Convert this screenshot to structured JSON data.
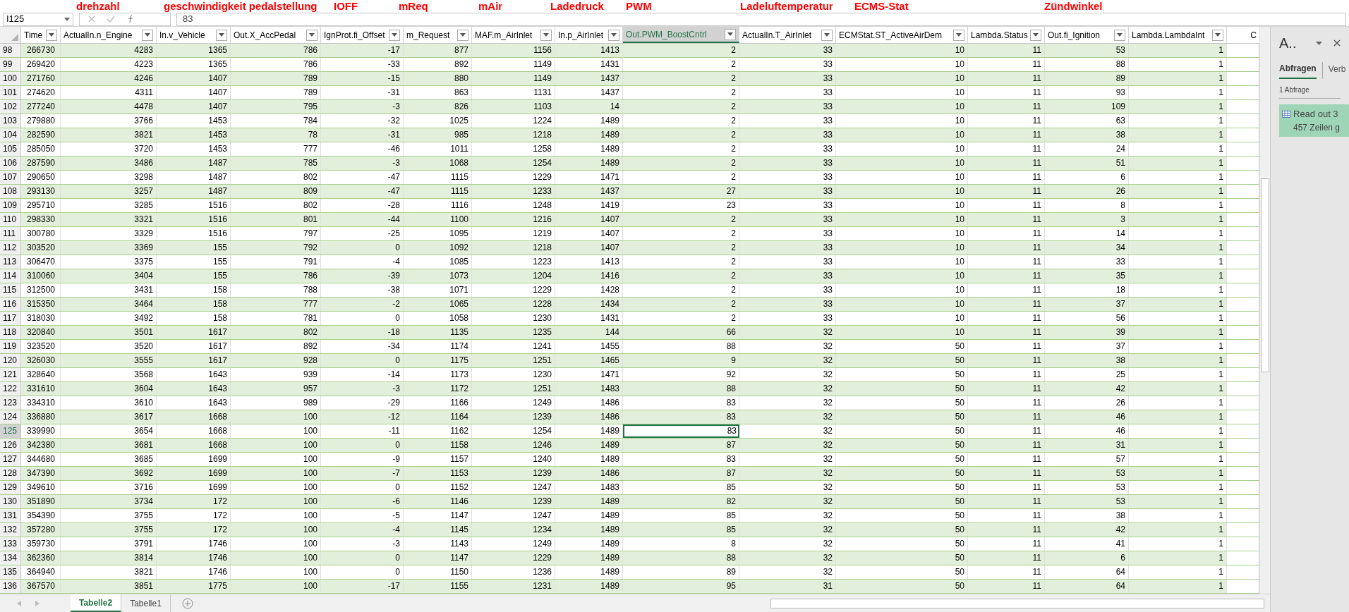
{
  "formula_bar": {
    "name_box": "I125",
    "formula": "83"
  },
  "annotations": [
    "drehzahl",
    "geschwindigkeit pedalstellung",
    "IOFF",
    "mReq",
    "mAir",
    "Ladedruck",
    "PWM",
    "Ladeluftemperatur",
    "ECMS-Stat",
    "Zündwinkel"
  ],
  "table": {
    "columns": [
      {
        "label": "Time",
        "selected": false
      },
      {
        "label": "ActualIn.n_Engine",
        "selected": false
      },
      {
        "label": "In.v_Vehicle",
        "selected": false
      },
      {
        "label": "Out.X_AccPedal",
        "selected": false
      },
      {
        "label": "IgnProt.fi_Offset",
        "selected": false
      },
      {
        "label": "m_Request",
        "selected": false
      },
      {
        "label": "MAF.m_AirInlet",
        "selected": false
      },
      {
        "label": "In.p_AirInlet",
        "selected": false
      },
      {
        "label": "Out.PWM_BoostCntrl",
        "selected": true
      },
      {
        "label": "ActualIn.T_AirInlet",
        "selected": false
      },
      {
        "label": "ECMStat.ST_ActiveAirDem",
        "selected": false
      },
      {
        "label": "Lambda.Status",
        "selected": false
      },
      {
        "label": "Out.fi_Ignition",
        "selected": false
      },
      {
        "label": "Lambda.LambdaInt",
        "selected": false
      }
    ],
    "next_column_header": "C",
    "rows": [
      {
        "number": "98",
        "selected": false,
        "cells": [
          "266730",
          "4283",
          "1365",
          "786",
          "-17",
          "877",
          "1156",
          "1413",
          "2",
          "33",
          "10",
          "11",
          "53",
          "1"
        ]
      },
      {
        "number": "99",
        "selected": false,
        "cells": [
          "269420",
          "4223",
          "1365",
          "786",
          "-33",
          "892",
          "1149",
          "1431",
          "2",
          "33",
          "10",
          "11",
          "88",
          "1"
        ]
      },
      {
        "number": "100",
        "selected": false,
        "cells": [
          "271760",
          "4246",
          "1407",
          "789",
          "-15",
          "880",
          "1149",
          "1437",
          "2",
          "33",
          "10",
          "11",
          "89",
          "1"
        ]
      },
      {
        "number": "101",
        "selected": false,
        "cells": [
          "274620",
          "4311",
          "1407",
          "789",
          "-31",
          "863",
          "1131",
          "1437",
          "2",
          "33",
          "10",
          "11",
          "93",
          "1"
        ]
      },
      {
        "number": "102",
        "selected": false,
        "cells": [
          "277240",
          "4478",
          "1407",
          "795",
          "-3",
          "826",
          "1103",
          "14",
          "2",
          "33",
          "10",
          "11",
          "109",
          "1"
        ]
      },
      {
        "number": "103",
        "selected": false,
        "cells": [
          "279880",
          "3766",
          "1453",
          "784",
          "-32",
          "1025",
          "1224",
          "1489",
          "2",
          "33",
          "10",
          "11",
          "63",
          "1"
        ]
      },
      {
        "number": "104",
        "selected": false,
        "cells": [
          "282590",
          "3821",
          "1453",
          "78",
          "-31",
          "985",
          "1218",
          "1489",
          "2",
          "33",
          "10",
          "11",
          "38",
          "1"
        ]
      },
      {
        "number": "105",
        "selected": false,
        "cells": [
          "285050",
          "3720",
          "1453",
          "777",
          "-46",
          "1011",
          "1258",
          "1489",
          "2",
          "33",
          "10",
          "11",
          "24",
          "1"
        ]
      },
      {
        "number": "106",
        "selected": false,
        "cells": [
          "287590",
          "3486",
          "1487",
          "785",
          "-3",
          "1068",
          "1254",
          "1489",
          "2",
          "33",
          "10",
          "11",
          "51",
          "1"
        ]
      },
      {
        "number": "107",
        "selected": false,
        "cells": [
          "290650",
          "3298",
          "1487",
          "802",
          "-47",
          "1115",
          "1229",
          "1471",
          "2",
          "33",
          "10",
          "11",
          "6",
          "1"
        ]
      },
      {
        "number": "108",
        "selected": false,
        "cells": [
          "293130",
          "3257",
          "1487",
          "809",
          "-47",
          "1115",
          "1233",
          "1437",
          "27",
          "33",
          "10",
          "11",
          "26",
          "1"
        ]
      },
      {
        "number": "109",
        "selected": false,
        "cells": [
          "295710",
          "3285",
          "1516",
          "802",
          "-28",
          "1116",
          "1248",
          "1419",
          "23",
          "33",
          "10",
          "11",
          "8",
          "1"
        ]
      },
      {
        "number": "110",
        "selected": false,
        "cells": [
          "298330",
          "3321",
          "1516",
          "801",
          "-44",
          "1100",
          "1216",
          "1407",
          "2",
          "33",
          "10",
          "11",
          "3",
          "1"
        ]
      },
      {
        "number": "111",
        "selected": false,
        "cells": [
          "300780",
          "3329",
          "1516",
          "797",
          "-25",
          "1095",
          "1219",
          "1407",
          "2",
          "33",
          "10",
          "11",
          "14",
          "1"
        ]
      },
      {
        "number": "112",
        "selected": false,
        "cells": [
          "303520",
          "3369",
          "155",
          "792",
          "0",
          "1092",
          "1218",
          "1407",
          "2",
          "33",
          "10",
          "11",
          "34",
          "1"
        ]
      },
      {
        "number": "113",
        "selected": false,
        "cells": [
          "306470",
          "3375",
          "155",
          "791",
          "-4",
          "1085",
          "1223",
          "1413",
          "2",
          "33",
          "10",
          "11",
          "33",
          "1"
        ]
      },
      {
        "number": "114",
        "selected": false,
        "cells": [
          "310060",
          "3404",
          "155",
          "786",
          "-39",
          "1073",
          "1204",
          "1416",
          "2",
          "33",
          "10",
          "11",
          "35",
          "1"
        ]
      },
      {
        "number": "115",
        "selected": false,
        "cells": [
          "312500",
          "3431",
          "158",
          "788",
          "-38",
          "1071",
          "1229",
          "1428",
          "2",
          "33",
          "10",
          "11",
          "18",
          "1"
        ]
      },
      {
        "number": "116",
        "selected": false,
        "cells": [
          "315350",
          "3464",
          "158",
          "777",
          "-2",
          "1065",
          "1228",
          "1434",
          "2",
          "33",
          "10",
          "11",
          "37",
          "1"
        ]
      },
      {
        "number": "117",
        "selected": false,
        "cells": [
          "318030",
          "3492",
          "158",
          "781",
          "0",
          "1058",
          "1230",
          "1431",
          "2",
          "33",
          "10",
          "11",
          "56",
          "1"
        ]
      },
      {
        "number": "118",
        "selected": false,
        "cells": [
          "320840",
          "3501",
          "1617",
          "802",
          "-18",
          "1135",
          "1235",
          "144",
          "66",
          "32",
          "10",
          "11",
          "39",
          "1"
        ]
      },
      {
        "number": "119",
        "selected": false,
        "cells": [
          "323520",
          "3520",
          "1617",
          "892",
          "-34",
          "1174",
          "1241",
          "1455",
          "88",
          "32",
          "50",
          "11",
          "37",
          "1"
        ]
      },
      {
        "number": "120",
        "selected": false,
        "cells": [
          "326030",
          "3555",
          "1617",
          "928",
          "0",
          "1175",
          "1251",
          "1465",
          "9",
          "32",
          "50",
          "11",
          "38",
          "1"
        ]
      },
      {
        "number": "121",
        "selected": false,
        "cells": [
          "328640",
          "3568",
          "1643",
          "939",
          "-14",
          "1173",
          "1230",
          "1471",
          "92",
          "32",
          "50",
          "11",
          "25",
          "1"
        ]
      },
      {
        "number": "122",
        "selected": false,
        "cells": [
          "331610",
          "3604",
          "1643",
          "957",
          "-3",
          "1172",
          "1251",
          "1483",
          "88",
          "32",
          "50",
          "11",
          "42",
          "1"
        ]
      },
      {
        "number": "123",
        "selected": false,
        "cells": [
          "334310",
          "3610",
          "1643",
          "989",
          "-29",
          "1166",
          "1249",
          "1486",
          "83",
          "32",
          "50",
          "11",
          "26",
          "1"
        ]
      },
      {
        "number": "124",
        "selected": false,
        "cells": [
          "336880",
          "3617",
          "1668",
          "100",
          "-12",
          "1164",
          "1239",
          "1486",
          "83",
          "32",
          "50",
          "11",
          "46",
          "1"
        ]
      },
      {
        "number": "125",
        "selected": true,
        "cells": [
          "339990",
          "3654",
          "1668",
          "100",
          "-11",
          "1162",
          "1254",
          "1489",
          "83",
          "32",
          "50",
          "11",
          "46",
          "1"
        ]
      },
      {
        "number": "126",
        "selected": false,
        "cells": [
          "342380",
          "3681",
          "1668",
          "100",
          "0",
          "1158",
          "1246",
          "1489",
          "87",
          "32",
          "50",
          "11",
          "31",
          "1"
        ]
      },
      {
        "number": "127",
        "selected": false,
        "cells": [
          "344680",
          "3685",
          "1699",
          "100",
          "-9",
          "1157",
          "1240",
          "1489",
          "83",
          "32",
          "50",
          "11",
          "57",
          "1"
        ]
      },
      {
        "number": "128",
        "selected": false,
        "cells": [
          "347390",
          "3692",
          "1699",
          "100",
          "-7",
          "1153",
          "1239",
          "1486",
          "87",
          "32",
          "50",
          "11",
          "53",
          "1"
        ]
      },
      {
        "number": "129",
        "selected": false,
        "cells": [
          "349610",
          "3716",
          "1699",
          "100",
          "0",
          "1152",
          "1247",
          "1483",
          "85",
          "32",
          "50",
          "11",
          "53",
          "1"
        ]
      },
      {
        "number": "130",
        "selected": false,
        "cells": [
          "351890",
          "3734",
          "172",
          "100",
          "-6",
          "1146",
          "1239",
          "1489",
          "82",
          "32",
          "50",
          "11",
          "53",
          "1"
        ]
      },
      {
        "number": "131",
        "selected": false,
        "cells": [
          "354390",
          "3755",
          "172",
          "100",
          "-5",
          "1147",
          "1247",
          "1489",
          "85",
          "32",
          "50",
          "11",
          "38",
          "1"
        ]
      },
      {
        "number": "132",
        "selected": false,
        "cells": [
          "357280",
          "3755",
          "172",
          "100",
          "-4",
          "1145",
          "1234",
          "1489",
          "85",
          "32",
          "50",
          "11",
          "42",
          "1"
        ]
      },
      {
        "number": "133",
        "selected": false,
        "cells": [
          "359730",
          "3791",
          "1746",
          "100",
          "-3",
          "1143",
          "1249",
          "1489",
          "8",
          "32",
          "50",
          "11",
          "41",
          "1"
        ]
      },
      {
        "number": "134",
        "selected": false,
        "cells": [
          "362360",
          "3814",
          "1746",
          "100",
          "0",
          "1147",
          "1229",
          "1489",
          "88",
          "32",
          "50",
          "11",
          "6",
          "1"
        ]
      },
      {
        "number": "135",
        "selected": false,
        "cells": [
          "364940",
          "3821",
          "1746",
          "100",
          "0",
          "1150",
          "1236",
          "1489",
          "89",
          "32",
          "50",
          "11",
          "64",
          "1"
        ]
      },
      {
        "number": "136",
        "selected": false,
        "cells": [
          "367570",
          "3851",
          "1775",
          "100",
          "-17",
          "1155",
          "1231",
          "1489",
          "95",
          "31",
          "50",
          "11",
          "64",
          "1"
        ]
      }
    ]
  },
  "sheet_tabs": [
    {
      "label": "Tabelle2",
      "selected": true
    },
    {
      "label": "Tabelle1",
      "selected": false
    }
  ],
  "queries_pane": {
    "title": "A..",
    "tabs": [
      {
        "label": "Abfragen",
        "selected": true
      },
      {
        "label": "Verb",
        "selected": false
      }
    ],
    "count": "1 Abfrage",
    "query": {
      "name": "Read out 3",
      "rows": "457 Zeilen g"
    }
  }
}
